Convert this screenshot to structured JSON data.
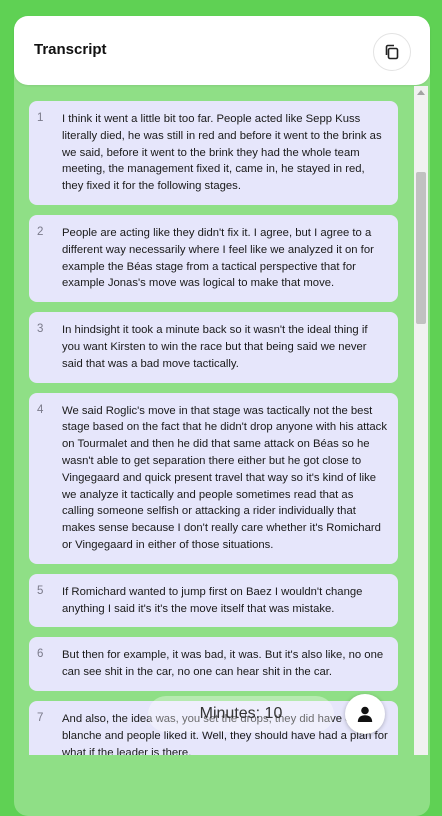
{
  "header": {
    "title": "Transcript",
    "copy_icon": "copy-icon"
  },
  "segments": [
    {
      "num": "1",
      "text": "I think it went a little bit too far. People acted like Sepp Kuss literally died, he was still in red and before it went to the brink as we said, before it went to the brink they had the whole team meeting, the management fixed it, came in, he stayed in red, they fixed it for the following stages."
    },
    {
      "num": "2",
      "text": "People are acting like they didn't fix it. I agree, but I agree to a different way necessarily where I feel like we analyzed it on for example the Béas stage from a tactical perspective that for example Jonas's move was logical to make that move."
    },
    {
      "num": "3",
      "text": "In hindsight it took a minute back so it wasn't the ideal thing if you want Kirsten to win the race but that being said we never said that was a bad move tactically."
    },
    {
      "num": "4",
      "text": "We said Roglic's move in that stage was tactically not the best stage based on the fact that he didn't drop anyone with his attack on Tourmalet and then he did that same attack on Béas so he wasn't able to get separation there either but he got close to Vingegaard and quick present travel that way so it's kind of like we analyze it tactically and people sometimes read that as calling someone selfish or attacking a rider individually that makes sense because I don't really care whether it's Romichard or Vingegaard in either of those situations."
    },
    {
      "num": "5",
      "text": "If Romichard wanted to jump first on Baez I wouldn't change anything I said it's it's the move itself that was mistake."
    },
    {
      "num": "6",
      "text": "But then for example, it was bad, it was. But it's also like, no one can see shit in the car, no one can hear shit in the car."
    },
    {
      "num": "7",
      "text": "And also, the idea was, you set the drops, they did have carte blanche and people liked it. Well, they should have had a plan for what if the leader is there."
    }
  ],
  "footer": {
    "minutes_label": "Minutes: 10",
    "user_icon": "user-icon"
  }
}
